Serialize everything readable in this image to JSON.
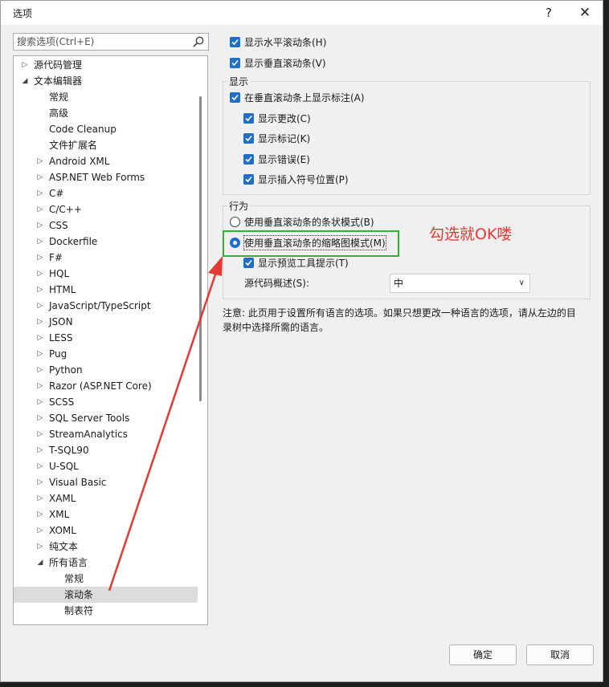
{
  "window": {
    "title": "选项",
    "help_label": "?",
    "close_label": "✕"
  },
  "search": {
    "placeholder": "搜索选项(Ctrl+E)",
    "icon": "search-icon"
  },
  "tree": {
    "items": [
      {
        "label": "源代码管理",
        "level": 0,
        "arrow": "▷"
      },
      {
        "label": "文本编辑器",
        "level": 0,
        "arrow": "◢"
      },
      {
        "label": "常规",
        "level": 1,
        "arrow": ""
      },
      {
        "label": "高级",
        "level": 1,
        "arrow": ""
      },
      {
        "label": "Code Cleanup",
        "level": 1,
        "arrow": ""
      },
      {
        "label": "文件扩展名",
        "level": 1,
        "arrow": ""
      },
      {
        "label": "Android XML",
        "level": 1,
        "arrow": "▷"
      },
      {
        "label": "ASP.NET Web Forms",
        "level": 1,
        "arrow": "▷"
      },
      {
        "label": "C#",
        "level": 1,
        "arrow": "▷"
      },
      {
        "label": "C/C++",
        "level": 1,
        "arrow": "▷"
      },
      {
        "label": "CSS",
        "level": 1,
        "arrow": "▷"
      },
      {
        "label": "Dockerfile",
        "level": 1,
        "arrow": "▷"
      },
      {
        "label": "F#",
        "level": 1,
        "arrow": "▷"
      },
      {
        "label": "HQL",
        "level": 1,
        "arrow": "▷"
      },
      {
        "label": "HTML",
        "level": 1,
        "arrow": "▷"
      },
      {
        "label": "JavaScript/TypeScript",
        "level": 1,
        "arrow": "▷"
      },
      {
        "label": "JSON",
        "level": 1,
        "arrow": "▷"
      },
      {
        "label": "LESS",
        "level": 1,
        "arrow": "▷"
      },
      {
        "label": "Pug",
        "level": 1,
        "arrow": "▷"
      },
      {
        "label": "Python",
        "level": 1,
        "arrow": "▷"
      },
      {
        "label": "Razor (ASP.NET Core)",
        "level": 1,
        "arrow": "▷"
      },
      {
        "label": "SCSS",
        "level": 1,
        "arrow": "▷"
      },
      {
        "label": "SQL Server Tools",
        "level": 1,
        "arrow": "▷"
      },
      {
        "label": "StreamAnalytics",
        "level": 1,
        "arrow": "▷"
      },
      {
        "label": "T-SQL90",
        "level": 1,
        "arrow": "▷"
      },
      {
        "label": "U-SQL",
        "level": 1,
        "arrow": "▷"
      },
      {
        "label": "Visual Basic",
        "level": 1,
        "arrow": "▷"
      },
      {
        "label": "XAML",
        "level": 1,
        "arrow": "▷"
      },
      {
        "label": "XML",
        "level": 1,
        "arrow": "▷"
      },
      {
        "label": "XOML",
        "level": 1,
        "arrow": "▷"
      },
      {
        "label": "纯文本",
        "level": 1,
        "arrow": "▷"
      },
      {
        "label": "所有语言",
        "level": 1,
        "arrow": "◢"
      },
      {
        "label": "常规",
        "level": 2,
        "arrow": ""
      },
      {
        "label": "滚动条",
        "level": 2,
        "arrow": "",
        "selected": true
      },
      {
        "label": "制表符",
        "level": 2,
        "arrow": ""
      }
    ]
  },
  "options": {
    "show_hscroll": "显示水平滚动条(H)",
    "show_vscroll": "显示垂直滚动条(V)",
    "display_group": {
      "title": "显示",
      "show_annotations": "在垂直滚动条上显示标注(A)",
      "show_changes": "显示更改(C)",
      "show_marks": "显示标记(K)",
      "show_errors": "显示错误(E)",
      "show_caret": "显示插入符号位置(P)"
    },
    "behavior_group": {
      "title": "行为",
      "bar_mode": "使用垂直滚动条的条状模式(B)",
      "map_mode": "使用垂直滚动条的缩略图模式(M)",
      "show_preview": "显示预览工具提示(T)",
      "overview_label": "源代码概述(S):",
      "overview_value": "中"
    },
    "note": "注意: 此页用于设置所有语言的选项。如果只想更改一种语言的选项，请从左边的目录树中选择所需的语言。"
  },
  "annotation": {
    "text": "勾选就OK喽",
    "color": "#e53935",
    "box_color": "#2fb32f"
  },
  "buttons": {
    "ok": "确定",
    "cancel": "取消"
  }
}
